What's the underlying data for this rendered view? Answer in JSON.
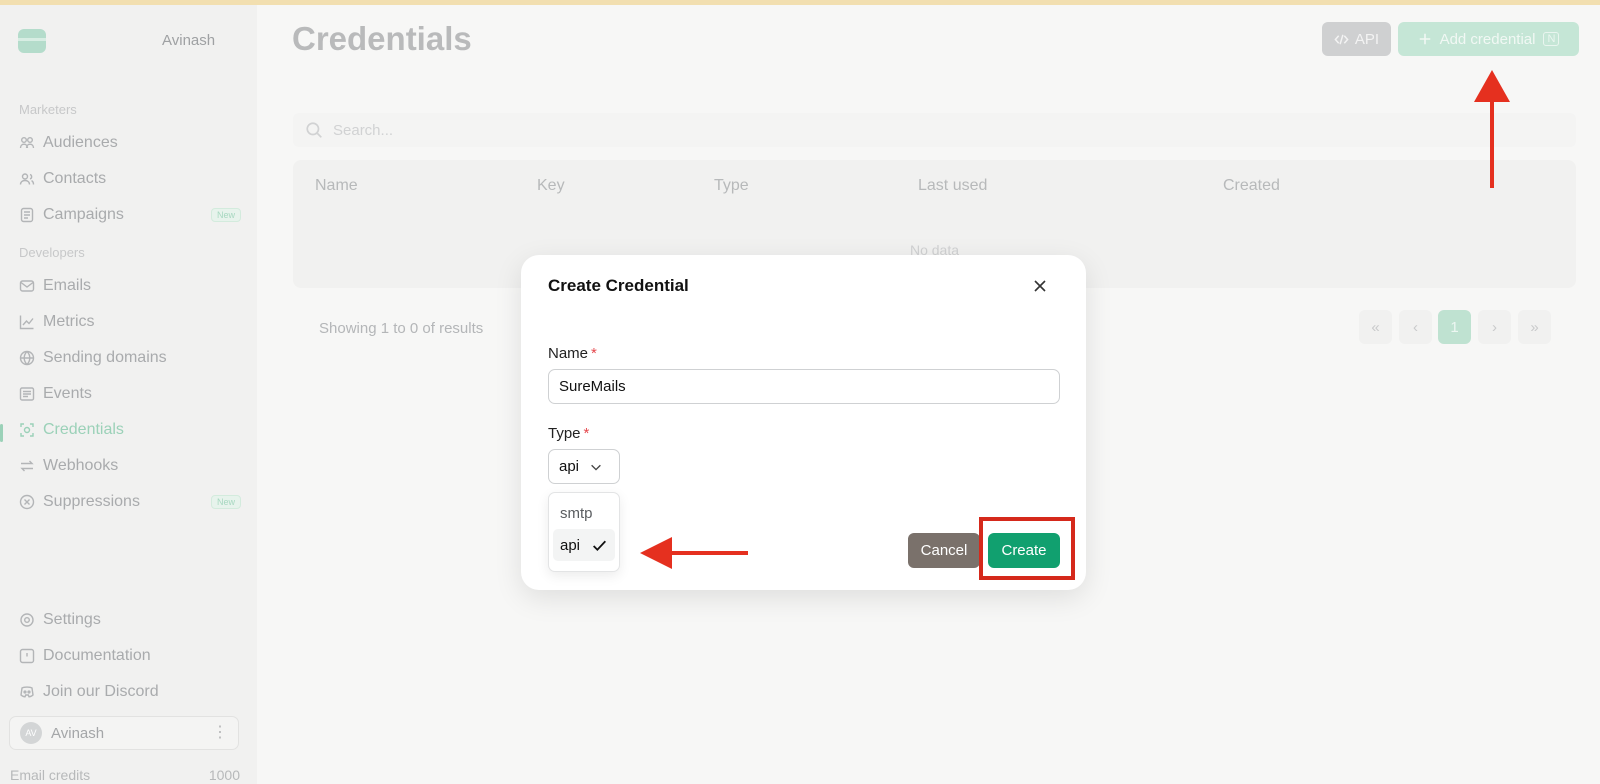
{
  "sidebar": {
    "workspace": "Avinash",
    "sections": {
      "marketers": "Marketers",
      "developers": "Developers"
    },
    "items": [
      {
        "label": "Audiences",
        "icon": "audiences-icon"
      },
      {
        "label": "Contacts",
        "icon": "contacts-icon"
      },
      {
        "label": "Campaigns",
        "icon": "campaigns-icon",
        "badge": "New"
      },
      {
        "label": "Emails",
        "icon": "mail-icon"
      },
      {
        "label": "Metrics",
        "icon": "chart-icon"
      },
      {
        "label": "Sending domains",
        "icon": "globe-icon"
      },
      {
        "label": "Events",
        "icon": "events-icon"
      },
      {
        "label": "Credentials",
        "icon": "key-icon",
        "active": true
      },
      {
        "label": "Webhooks",
        "icon": "webhook-icon"
      },
      {
        "label": "Suppressions",
        "icon": "block-icon",
        "badge": "New"
      },
      {
        "label": "Settings",
        "icon": "gear-icon"
      },
      {
        "label": "Documentation",
        "icon": "docs-icon"
      },
      {
        "label": "Join our Discord",
        "icon": "discord-icon"
      }
    ],
    "user": {
      "initials": "AV",
      "name": "Avinash"
    },
    "credits": {
      "label": "Email credits",
      "value": "1000"
    }
  },
  "main": {
    "title": "Credentials",
    "api_button": "API",
    "add_button": "Add credential",
    "add_shortcut": "N",
    "search_placeholder": "Search...",
    "table": {
      "columns": [
        "Name",
        "Key",
        "Type",
        "Last used",
        "Created"
      ],
      "empty": "No data"
    },
    "pagination": {
      "summary": "Showing 1 to 0 of results",
      "current_page": "1"
    }
  },
  "modal": {
    "title": "Create Credential",
    "name_label": "Name",
    "name_value": "SureMails",
    "type_label": "Type",
    "type_value": "api",
    "required_mark": "*",
    "type_options": [
      "smtp",
      "api"
    ],
    "cancel": "Cancel",
    "create": "Create"
  },
  "colors": {
    "accent": "#11a06f",
    "annotation": "#d5291b",
    "cancel": "#7a716b"
  }
}
